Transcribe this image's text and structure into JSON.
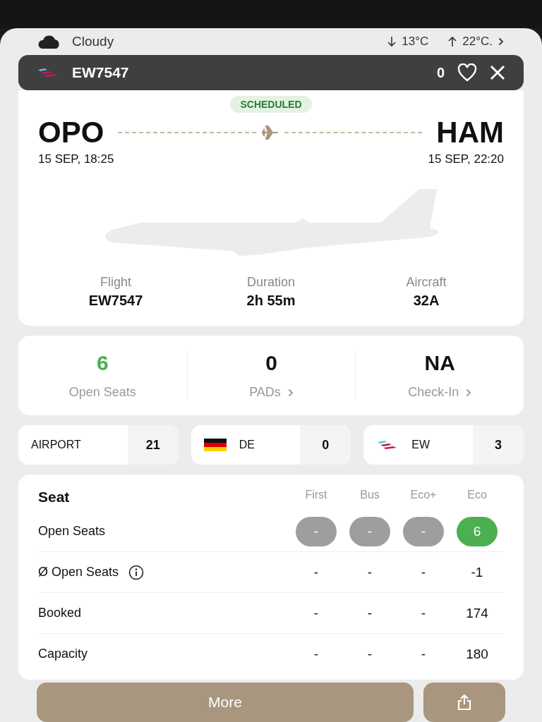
{
  "weather": {
    "condition": "Cloudy",
    "low": "13°C",
    "high": "22°C."
  },
  "header": {
    "flight": "EW7547",
    "count": "0",
    "favorite": false
  },
  "status": {
    "label": "SCHEDULED"
  },
  "route": {
    "origin": {
      "code": "OPO",
      "time": "15 SEP, 18:25"
    },
    "destination": {
      "code": "HAM",
      "time": "15 SEP, 22:20"
    }
  },
  "info": [
    {
      "label": "Flight",
      "value": "EW7547"
    },
    {
      "label": "Duration",
      "value": "2h 55m"
    },
    {
      "label": "Aircraft",
      "value": "32A"
    }
  ],
  "stats": [
    {
      "value": "6",
      "label": "Open Seats",
      "kind": "positive",
      "chevron": false
    },
    {
      "value": "0",
      "label": "PADs",
      "kind": "neutral",
      "chevron": true
    },
    {
      "value": "NA",
      "label": "Check-In",
      "kind": "neutral",
      "chevron": true
    }
  ],
  "chips": [
    {
      "kind": "text",
      "label": "AIRPORT",
      "count": "21"
    },
    {
      "kind": "flag",
      "label": "DE",
      "count": "0"
    },
    {
      "kind": "airline",
      "label": "EW",
      "count": "3"
    }
  ],
  "seat_table": {
    "title": "Seat",
    "columns": [
      "First",
      "Bus",
      "Eco+",
      "Eco"
    ],
    "rows": [
      {
        "label": "Open Seats",
        "kind": "pills",
        "info": false,
        "cells": [
          {
            "value": "-",
            "available": false
          },
          {
            "value": "-",
            "available": false
          },
          {
            "value": "-",
            "available": false
          },
          {
            "value": "6",
            "available": true
          }
        ]
      },
      {
        "label": "Ø Open Seats",
        "kind": "text",
        "info": true,
        "cells": [
          {
            "value": "-"
          },
          {
            "value": "-"
          },
          {
            "value": "-"
          },
          {
            "value": "-1"
          }
        ]
      },
      {
        "label": "Booked",
        "kind": "text",
        "info": false,
        "cells": [
          {
            "value": "-"
          },
          {
            "value": "-"
          },
          {
            "value": "-"
          },
          {
            "value": "174"
          }
        ]
      },
      {
        "label": "Capacity",
        "kind": "text",
        "info": false,
        "cells": [
          {
            "value": "-"
          },
          {
            "value": "-"
          },
          {
            "value": "-"
          },
          {
            "value": "180"
          }
        ]
      }
    ]
  },
  "actions": {
    "more": "More"
  }
}
